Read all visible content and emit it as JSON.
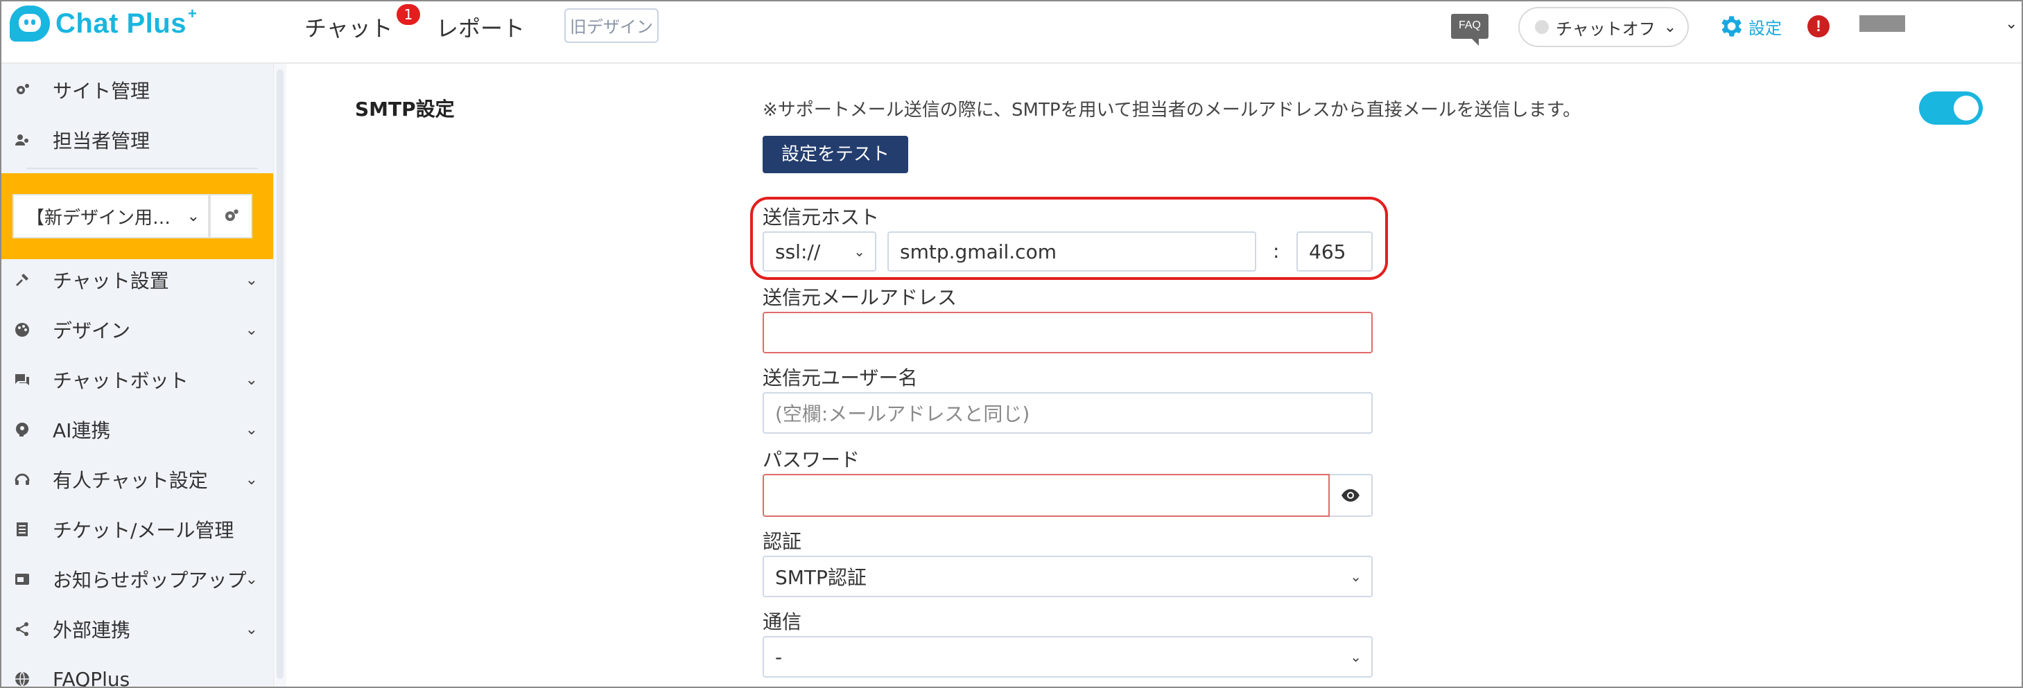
{
  "header": {
    "logo_text": "Chat Plus",
    "logo_plus": "+",
    "nav": {
      "chat": "チャット",
      "chat_badge": "1",
      "report": "レポート"
    },
    "old_design": "旧デザイン",
    "faq": "FAQ",
    "chat_status": "チャットオフ",
    "settings": "設定",
    "alert": "!",
    "chevron": "⌄"
  },
  "sidebar": {
    "site_management": "サイト管理",
    "staff_management": "担当者管理",
    "site_select": "【新デザイン用…",
    "items": [
      {
        "label": "チャット設置",
        "icon": "tools-icon"
      },
      {
        "label": "デザイン",
        "icon": "palette-icon"
      },
      {
        "label": "チャットボット",
        "icon": "chat-bubbles-icon"
      },
      {
        "label": "AI連携",
        "icon": "ai-head-icon"
      },
      {
        "label": "有人チャット設定",
        "icon": "headset-icon"
      },
      {
        "label": "チケット/メール管理",
        "icon": "ticket-list-icon"
      },
      {
        "label": "お知らせポップアップ",
        "icon": "popup-window-icon"
      },
      {
        "label": "外部連携",
        "icon": "share-icon"
      },
      {
        "label": "FAQPlus",
        "icon": "globe-icon"
      }
    ]
  },
  "smtp": {
    "title": "SMTP設定",
    "description": "※サポートメール送信の際に、SMTPを用いて担当者のメールアドレスから直接メールを送信します。",
    "enabled": true,
    "test_button": "設定をテスト",
    "host_label": "送信元ホスト",
    "protocol": "ssl://",
    "host": "smtp.gmail.com",
    "colon": ":",
    "port": "465",
    "email_label": "送信元メールアドレス",
    "email_value": "",
    "username_label": "送信元ユーザー名",
    "username_placeholder": "(空欄:メールアドレスと同じ)",
    "password_label": "パスワード",
    "password_value": "",
    "auth_label": "認証",
    "auth_value": "SMTP認証",
    "comm_label": "通信",
    "comm_value": "-"
  },
  "colors": {
    "accent": "#19b6df",
    "site_box": "#ffb300",
    "button": "#233d6e",
    "error_border": "#e16a6a",
    "highlight": "#e41e1e"
  }
}
